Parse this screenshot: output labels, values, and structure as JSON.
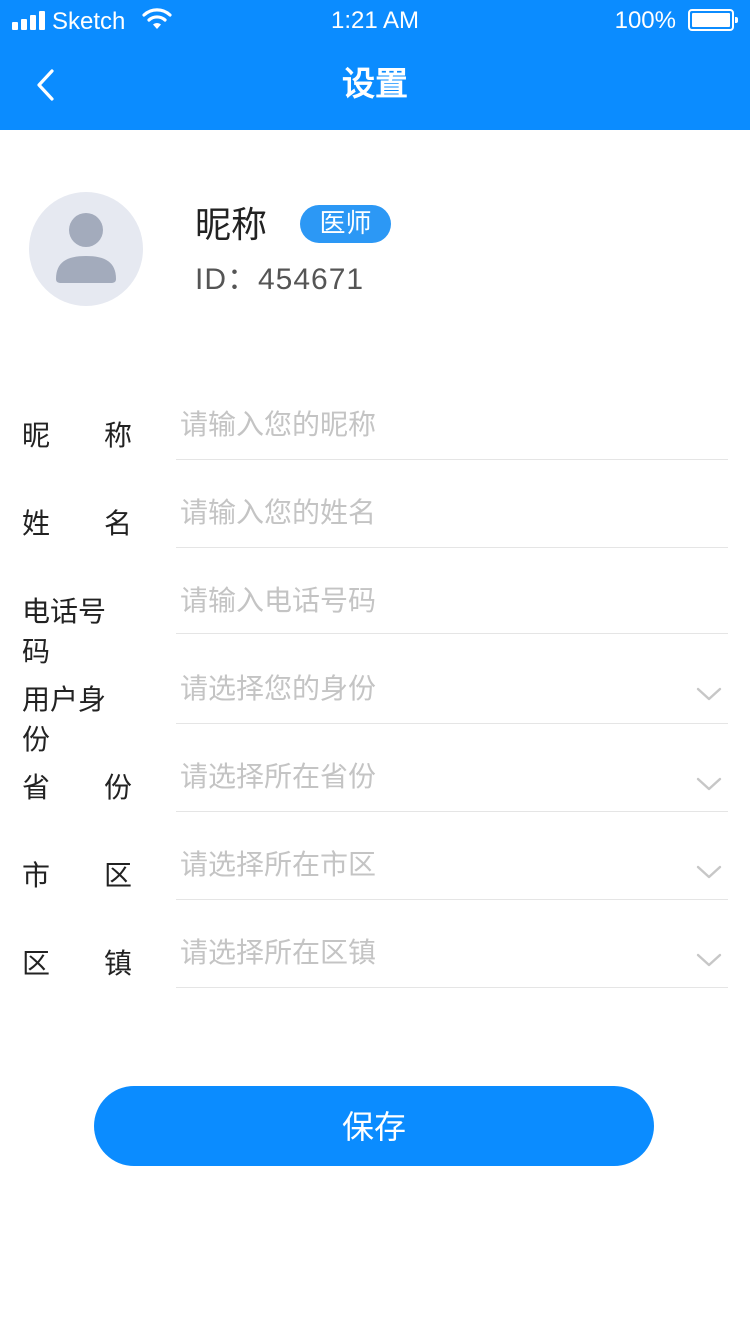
{
  "status_bar": {
    "carrier": "Sketch",
    "time": "1:21 AM",
    "battery_percent": "100%",
    "signal_bars": 4,
    "battery_level": 1.0
  },
  "nav": {
    "title": "设置",
    "back_icon": "chevron-left-icon"
  },
  "profile": {
    "avatar_icon": "user-avatar-icon",
    "name": "昵称",
    "role_badge": "医师",
    "id_text": "ID：454671"
  },
  "form": {
    "fields": [
      {
        "label_a": "昵",
        "label_b": "称",
        "placeholder": "请输入您的昵称",
        "type": "input"
      },
      {
        "label_a": "姓",
        "label_b": "名",
        "placeholder": "请输入您的姓名",
        "type": "input"
      },
      {
        "label_full": "电话号码",
        "placeholder": "请输入电话号码",
        "type": "input"
      },
      {
        "label_full": "用户身份",
        "placeholder": "请选择您的身份",
        "type": "select"
      },
      {
        "label_a": "省",
        "label_b": "份",
        "placeholder": "请选择所在省份",
        "type": "select"
      },
      {
        "label_a": "市",
        "label_b": "区",
        "placeholder": "请选择所在市区",
        "type": "select"
      },
      {
        "label_a": "区",
        "label_b": "镇",
        "placeholder": "请选择所在区镇",
        "type": "select"
      }
    ]
  },
  "save_button": {
    "label": "保存"
  },
  "colors": {
    "primary": "#0b8cff",
    "badge": "#2c98f5",
    "placeholder": "#c4c4c4",
    "divider": "#e5e5e5",
    "avatar_bg": "#e6e9f1",
    "avatar_fg": "#a3abbc"
  }
}
